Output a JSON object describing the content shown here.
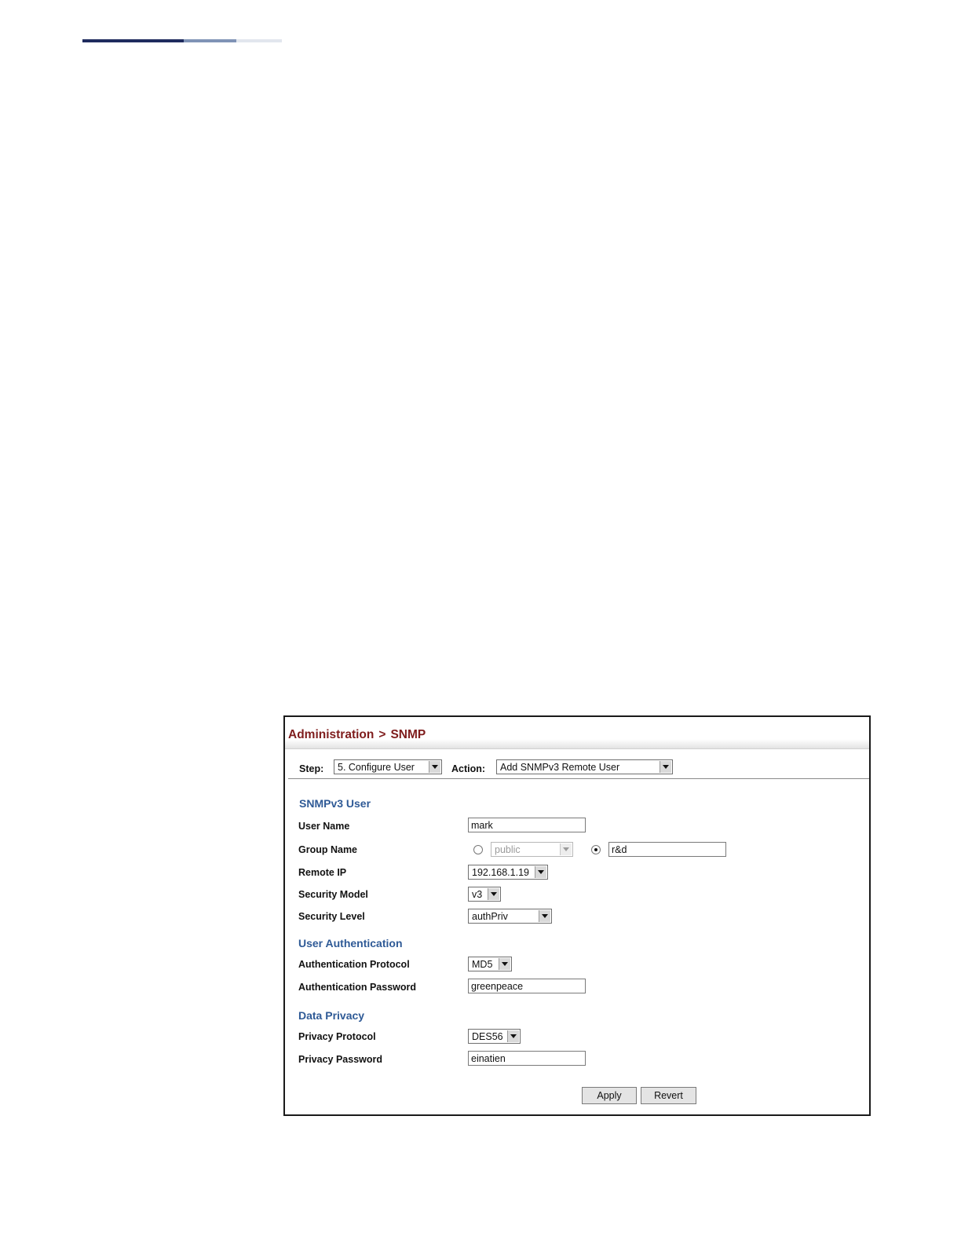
{
  "breadcrumb": {
    "parent": "Administration",
    "separator": ">",
    "current": "SNMP"
  },
  "toolbar": {
    "step_label": "Step:",
    "step_value": "5. Configure User",
    "action_label": "Action:",
    "action_value": "Add SNMPv3 Remote User"
  },
  "sections": {
    "user": "SNMPv3 User",
    "auth": "User Authentication",
    "privacy": "Data Privacy"
  },
  "form": {
    "user_name": {
      "label": "User Name",
      "value": "mark"
    },
    "group_name": {
      "label": "Group Name",
      "select_value": "public",
      "select_selected": false,
      "text_value": "r&d",
      "text_selected": true
    },
    "remote_ip": {
      "label": "Remote IP",
      "value": "192.168.1.19"
    },
    "security_model": {
      "label": "Security Model",
      "value": "v3"
    },
    "security_level": {
      "label": "Security Level",
      "value": "authPriv"
    },
    "auth_protocol": {
      "label": "Authentication Protocol",
      "value": "MD5"
    },
    "auth_password": {
      "label": "Authentication Password",
      "value": "greenpeace"
    },
    "privacy_protocol": {
      "label": "Privacy Protocol",
      "value": "DES56"
    },
    "privacy_password": {
      "label": "Privacy Password",
      "value": "einatien"
    }
  },
  "buttons": {
    "apply": "Apply",
    "revert": "Revert"
  },
  "colors": {
    "breadcrumb": "#7f1d1d",
    "section_heading": "#2f5a96",
    "header_rule_dark": "#1f2b5e",
    "header_rule_mid": "#7f93b6",
    "header_rule_light": "#e2e6ee"
  }
}
